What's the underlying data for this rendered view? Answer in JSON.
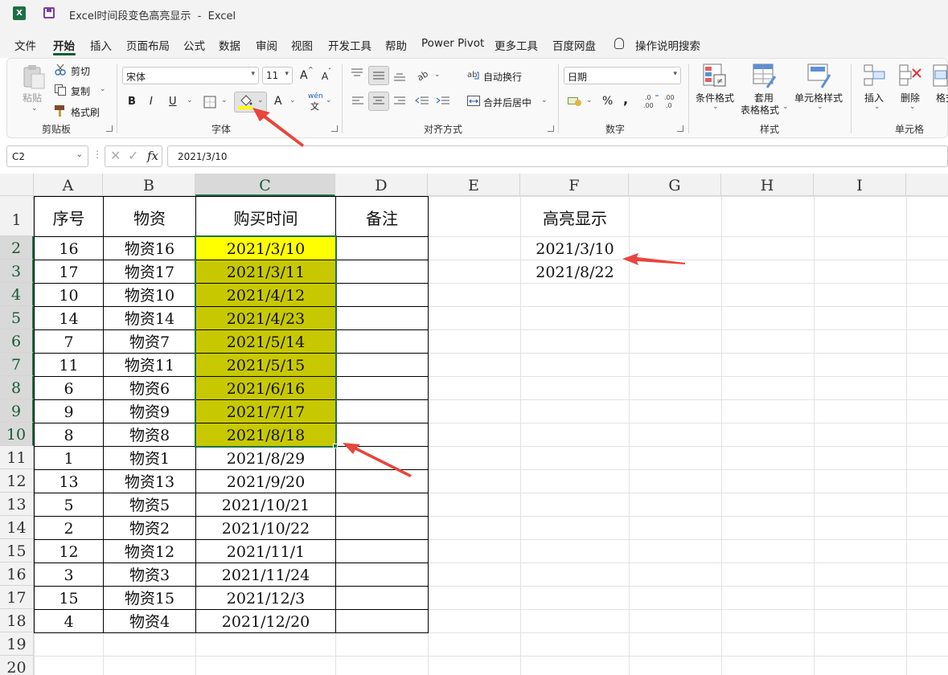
{
  "window": {
    "app_icon": "X",
    "title": "Excel时间段变色高亮显示  -  Excel"
  },
  "menu": [
    "文件",
    "开始",
    "插入",
    "页面布局",
    "公式",
    "数据",
    "审阅",
    "视图",
    "开发工具",
    "帮助",
    "Power Pivot",
    "更多工具",
    "百度网盘",
    "操作说明搜索"
  ],
  "ribbon": {
    "clipboard": {
      "paste": "粘贴",
      "cut": "剪切",
      "copy": "复制",
      "format_painter": "格式刷",
      "label": "剪贴板"
    },
    "font": {
      "font_name": "宋体",
      "font_size": "11",
      "bold": "B",
      "italic": "I",
      "underline": "U",
      "grow": "A",
      "shrink": "A",
      "font_color": "A",
      "phonetic": "wén",
      "label": "字体"
    },
    "alignment": {
      "wrap": "自动换行",
      "merge": "合并后居中",
      "label": "对齐方式"
    },
    "number": {
      "format": "日期",
      "percent": "%",
      "comma": ",",
      "label": "数字"
    },
    "styles": {
      "conditional": "条件格式",
      "table_1": "套用",
      "table_2": "表格格式",
      "cell_styles": "单元格样式",
      "label": "样式"
    },
    "cells": {
      "insert": "插入",
      "delete": "删除",
      "format": "格式",
      "label": "单元格"
    }
  },
  "formula_bar": {
    "name_box": "C2",
    "fx": "fx",
    "value": "2021/3/10"
  },
  "sheet": {
    "columns": [
      "A",
      "B",
      "C",
      "D",
      "E",
      "F",
      "G",
      "H",
      "I"
    ],
    "rows": [
      "1",
      "2",
      "3",
      "4",
      "5",
      "6",
      "7",
      "8",
      "9",
      "10",
      "11",
      "12",
      "13",
      "14",
      "15",
      "16",
      "17",
      "18",
      "19",
      "20"
    ],
    "headers": [
      "序号",
      "物资",
      "购买时间",
      "备注"
    ],
    "data": [
      [
        "16",
        "物资16",
        "2021/3/10"
      ],
      [
        "17",
        "物资17",
        "2021/3/11"
      ],
      [
        "10",
        "物资10",
        "2021/4/12"
      ],
      [
        "14",
        "物资14",
        "2021/4/23"
      ],
      [
        "7",
        "物资7",
        "2021/5/14"
      ],
      [
        "11",
        "物资11",
        "2021/5/15"
      ],
      [
        "6",
        "物资6",
        "2021/6/16"
      ],
      [
        "9",
        "物资9",
        "2021/7/17"
      ],
      [
        "8",
        "物资8",
        "2021/8/18"
      ],
      [
        "1",
        "物资1",
        "2021/8/29"
      ],
      [
        "13",
        "物资13",
        "2021/9/20"
      ],
      [
        "5",
        "物资5",
        "2021/10/21"
      ],
      [
        "2",
        "物资2",
        "2021/10/22"
      ],
      [
        "12",
        "物资12",
        "2021/11/1"
      ],
      [
        "3",
        "物资3",
        "2021/11/24"
      ],
      [
        "15",
        "物资15",
        "2021/12/3"
      ],
      [
        "4",
        "物资4",
        "2021/12/20"
      ]
    ],
    "highlight_title": "高亮显示",
    "highlight_start": "2021/3/10",
    "highlight_end": "2021/8/22",
    "highlight_color": "#ffff00",
    "range_fill_color": "#c8c800"
  }
}
